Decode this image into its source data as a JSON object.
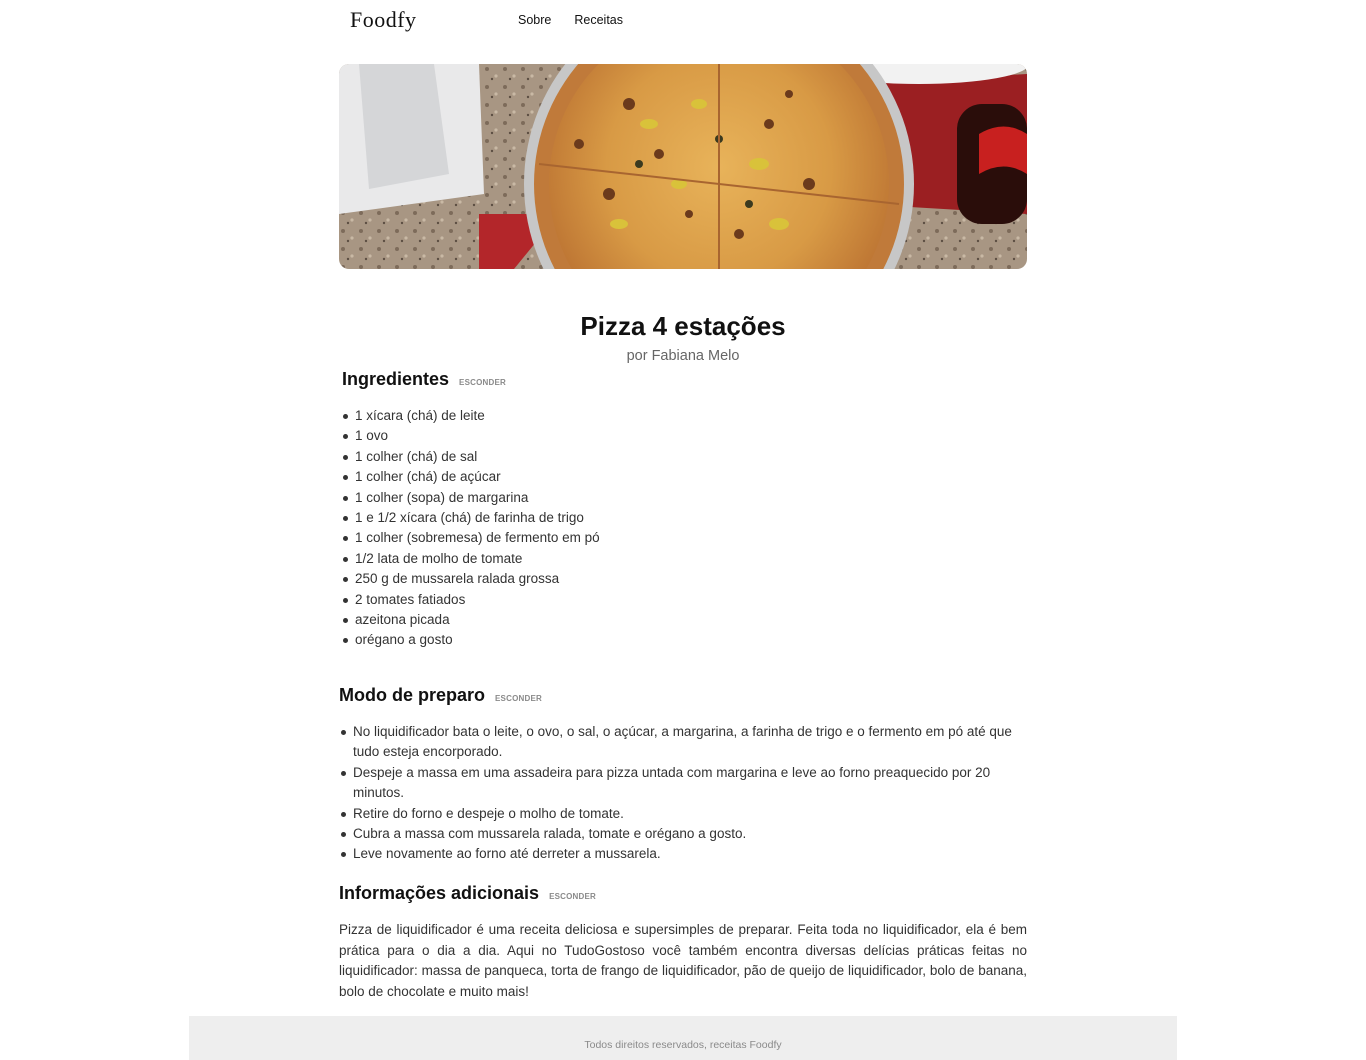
{
  "header": {
    "logo": "Foodfy",
    "nav": [
      {
        "label": "Sobre"
      },
      {
        "label": "Receitas"
      }
    ]
  },
  "recipe": {
    "title": "Pizza 4 estações",
    "author": "por Fabiana Melo"
  },
  "ingredients": {
    "heading": "Ingredientes",
    "toggle": "ESCONDER",
    "items": [
      "1 xícara (chá) de leite",
      "1 ovo",
      "1 colher (chá) de sal",
      "1 colher (chá) de açúcar",
      "1 colher (sopa) de margarina",
      "1 e 1/2 xícara (chá) de farinha de trigo",
      "1 colher (sobremesa) de fermento em pó",
      "1/2 lata de molho de tomate",
      "250 g de mussarela ralada grossa",
      "2 tomates fatiados",
      "azeitona picada",
      "orégano a gosto"
    ]
  },
  "method": {
    "heading": "Modo de preparo",
    "toggle": "ESCONDER",
    "items": [
      "No liquidificador bata o leite, o ovo, o sal, o açúcar, a margarina, a farinha de trigo e o fermento em pó até que tudo esteja encorporado.",
      "Despeje a massa em uma assadeira para pizza untada com margarina e leve ao forno preaquecido por 20 minutos.",
      "Retire do forno e despeje o molho de tomate.",
      "Cubra a massa com mussarela ralada, tomate e orégano a gosto.",
      "Leve novamente ao forno até derreter a mussarela."
    ]
  },
  "info": {
    "heading": "Informações adicionais",
    "toggle": "ESCONDER",
    "text": "Pizza de liquidificador é uma receita deliciosa e supersimples de preparar. Feita toda no liquidificador, ela é bem prática para o dia a dia. Aqui no TudoGostoso você também encontra diversas delícias práticas feitas no liquidificador: massa de panqueca, torta de frango de liquidificador, pão de queijo de liquidificador, bolo de banana, bolo de chocolate e muito mais!"
  },
  "footer": {
    "text": "Todos direitos reservados, receitas Foodfy"
  }
}
